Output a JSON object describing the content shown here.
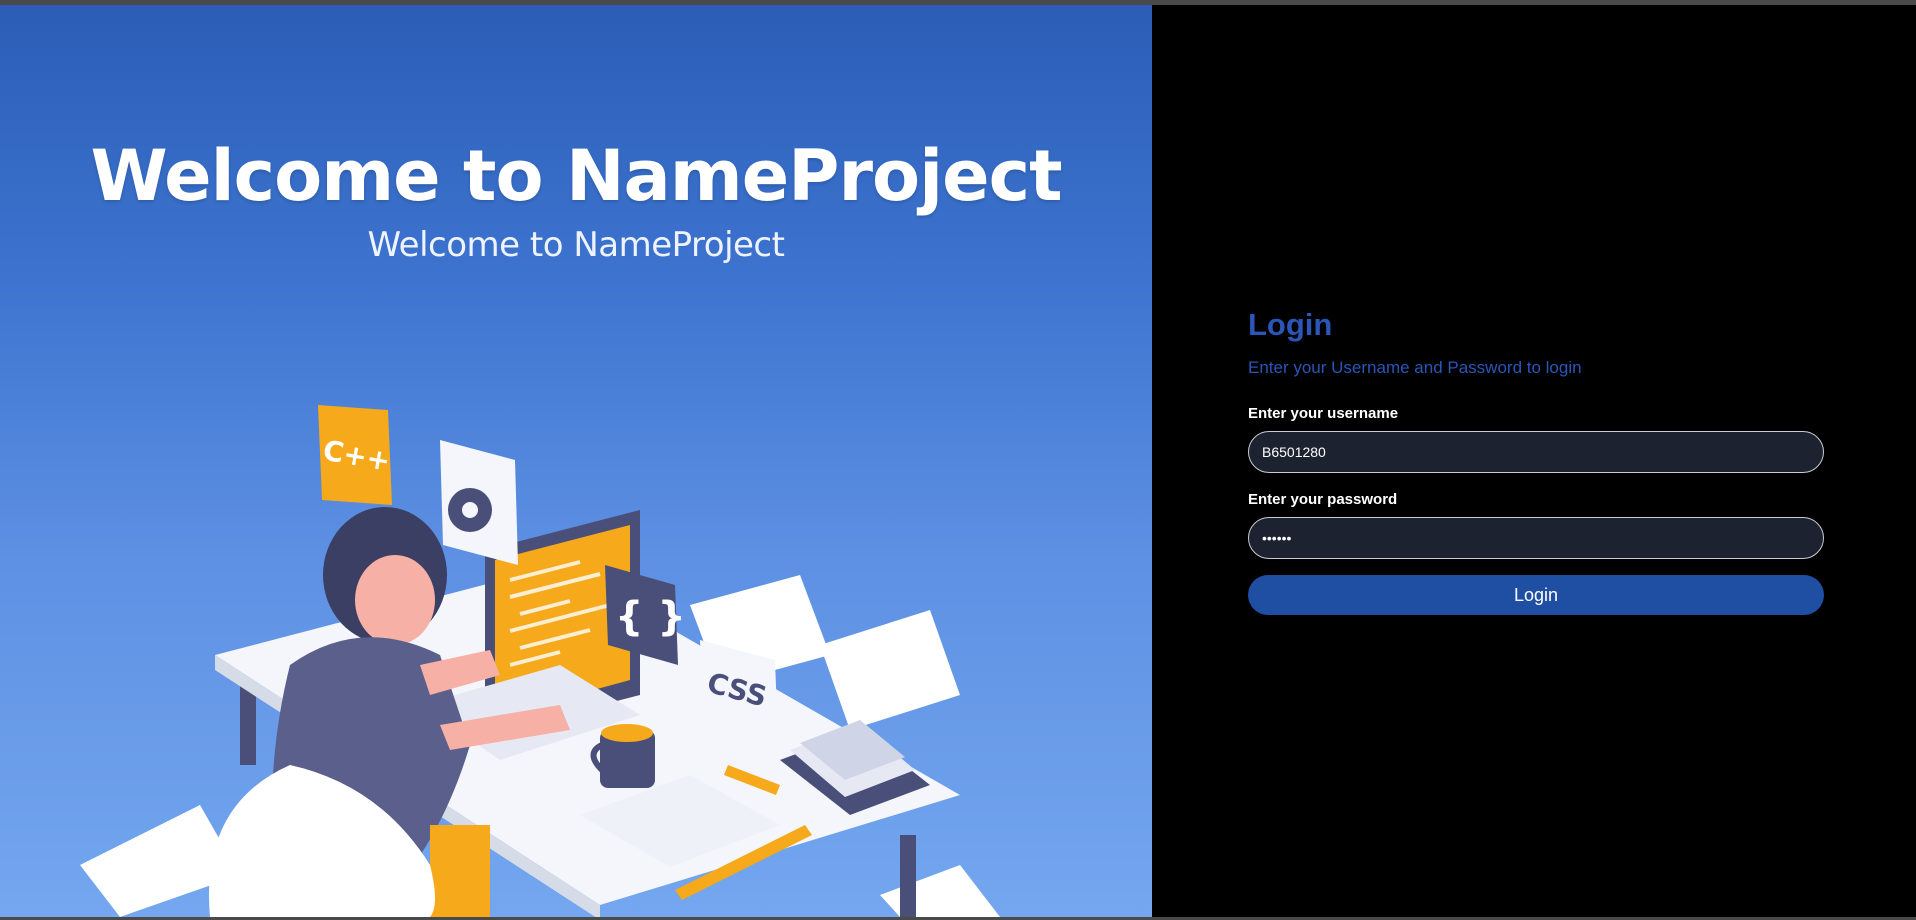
{
  "hero": {
    "title": "Welcome to NameProject",
    "subtitle": "Welcome to NameProject",
    "badges": {
      "cpp": "C++",
      "braces": "{ }",
      "css": "CSS"
    }
  },
  "login": {
    "heading": "Login",
    "subheading": "Enter your Username and Password to login",
    "username_label": "Enter your username",
    "username_value": "B6501280",
    "password_label": "Enter your password",
    "password_value": "123456",
    "button_label": "Login"
  },
  "colors": {
    "accent": "#2a56b8",
    "button": "#1f4fa3",
    "panel_bg": "#000000",
    "input_bg": "#1d2230"
  }
}
